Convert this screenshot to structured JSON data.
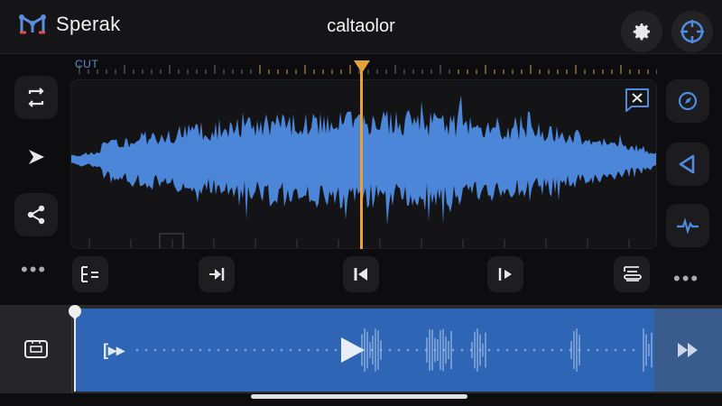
{
  "app": {
    "name": "Sperak",
    "title": "caltaolor",
    "accent": "#2f65b5",
    "playhead_color": "#e6a236",
    "wave_color": "#4b86d9"
  },
  "topbar": {
    "settings_icon": "gear-icon",
    "target_icon": "crosshair-icon"
  },
  "ruler": {
    "cut_label": "CUT"
  },
  "left_tools": [
    {
      "name": "loop-tool",
      "icon": "loop-icon"
    },
    {
      "name": "send-tool",
      "icon": "send-arrow-icon"
    },
    {
      "name": "share-tool",
      "icon": "share-icon"
    }
  ],
  "right_tools": [
    {
      "name": "compass-tool",
      "icon": "compass-icon"
    },
    {
      "name": "volume-tool",
      "icon": "speaker-icon"
    },
    {
      "name": "pulse-tool",
      "icon": "pulse-icon"
    }
  ],
  "controls": [
    {
      "name": "list-button",
      "icon": "list-icon"
    },
    {
      "name": "skip-to-start-button",
      "icon": "skip-forward-bar-icon"
    },
    {
      "name": "rewind-button",
      "icon": "back-bar-icon"
    },
    {
      "name": "play-next-button",
      "icon": "play-bar-icon"
    },
    {
      "name": "stack-button",
      "icon": "stack-icon"
    }
  ],
  "timeline": {
    "left_icon": "monitor-icon",
    "start_glyph": "[▸▸",
    "end_icon": "fast-forward-icon"
  }
}
